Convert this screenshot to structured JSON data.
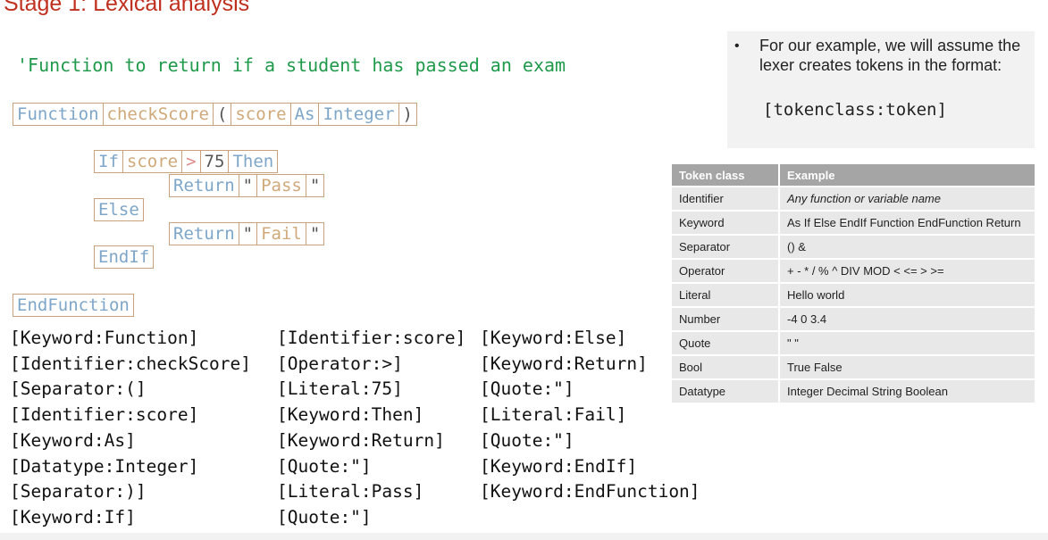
{
  "title": "Stage 1: Lexical analysis",
  "comment": "'Function to return if a student has passed an exam",
  "code": {
    "line1": [
      {
        "text": "Function",
        "cls": "kw"
      },
      {
        "text": "checkScore",
        "cls": "id"
      },
      {
        "text": "(",
        "cls": "sep"
      },
      {
        "text": "score",
        "cls": "id"
      },
      {
        "text": "As",
        "cls": "kw"
      },
      {
        "text": "Integer",
        "cls": "kw"
      },
      {
        "text": ")",
        "cls": "sep"
      }
    ],
    "line2": [
      {
        "text": "If",
        "cls": "kw"
      },
      {
        "text": "score",
        "cls": "id"
      },
      {
        "text": ">",
        "cls": "op"
      },
      {
        "text": "75",
        "cls": "num"
      },
      {
        "text": "Then",
        "cls": "kw"
      }
    ],
    "line3": [
      {
        "text": "Return",
        "cls": "kw"
      },
      {
        "text": "\"",
        "cls": "q"
      },
      {
        "text": "Pass",
        "cls": "lit"
      },
      {
        "text": "\"",
        "cls": "q"
      }
    ],
    "line4": [
      {
        "text": "Else",
        "cls": "kw"
      }
    ],
    "line5": [
      {
        "text": "Return",
        "cls": "kw"
      },
      {
        "text": "\"",
        "cls": "q"
      },
      {
        "text": "Fail",
        "cls": "lit"
      },
      {
        "text": "\"",
        "cls": "q"
      }
    ],
    "line6": [
      {
        "text": "EndIf",
        "cls": "kw"
      }
    ],
    "line7": [
      {
        "text": "EndFunction",
        "cls": "kw"
      }
    ]
  },
  "tokens": {
    "col1": [
      "[Keyword:Function]",
      "[Identifier:checkScore]",
      "[Separator:(]",
      "[Identifier:score]",
      "[Keyword:As]",
      "[Datatype:Integer]",
      "[Separator:)]",
      "[Keyword:If]"
    ],
    "col2": [
      "[Identifier:score]",
      "[Operator:>]",
      "[Literal:75]",
      "[Keyword:Then]",
      "[Keyword:Return]",
      "[Quote:\"]",
      "[Literal:Pass]",
      "[Quote:\"]"
    ],
    "col3": [
      "[Keyword:Else]",
      "[Keyword:Return]",
      "[Quote:\"]",
      "[Literal:Fail]",
      "[Quote:\"]",
      "[Keyword:EndIf]",
      "[Keyword:EndFunction]"
    ]
  },
  "info": {
    "bullet": "•",
    "text": "For our example, we will assume the lexer creates tokens in the format:",
    "format": "[tokenclass:token]"
  },
  "table": {
    "headers": [
      "Token class",
      "Example"
    ],
    "rows": [
      {
        "cls": "Identifier",
        "ex": "Any function or variable name",
        "italic": true
      },
      {
        "cls": "Keyword",
        "ex": "As If Else EndIf Function EndFunction Return"
      },
      {
        "cls": "Separator",
        "ex": "() &"
      },
      {
        "cls": "Operator",
        "ex": "+ - * / % ^ DIV MOD < <= > >="
      },
      {
        "cls": "Literal",
        "ex": "Hello world"
      },
      {
        "cls": "Number",
        "ex": "-4 0 3.4"
      },
      {
        "cls": "Quote",
        "ex": "\" \""
      },
      {
        "cls": "Bool",
        "ex": "True False"
      },
      {
        "cls": "Datatype",
        "ex": "Integer Decimal String Boolean"
      }
    ]
  },
  "colors": {
    "title": "#c0301e",
    "comment": "#1f9a4b",
    "keyword": "#7ea6c9",
    "identifier": "#d0a97a",
    "operator": "#e08a8a",
    "token_border": "#c9a27c",
    "table_header": "#a5a5a5",
    "table_row": "#e8e8e8"
  }
}
